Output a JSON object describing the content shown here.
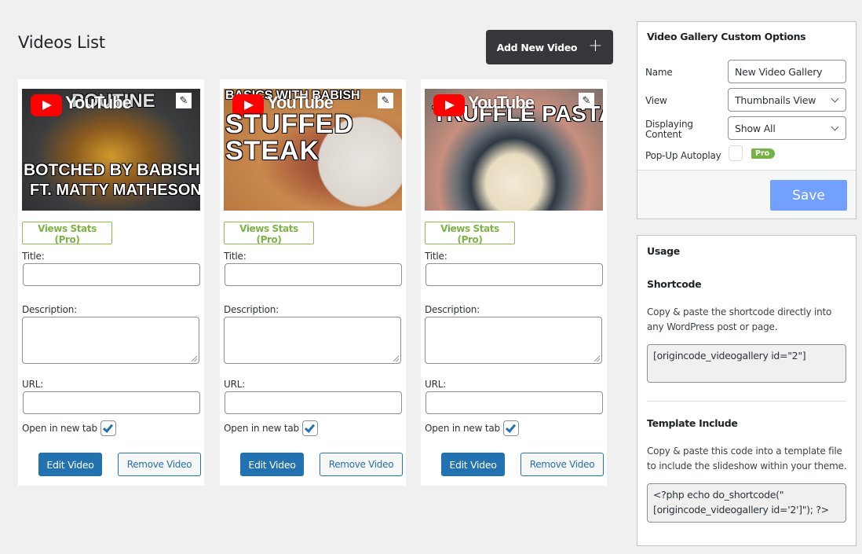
{
  "page": {
    "title": "Videos List",
    "add_button_label": "Add New Video",
    "add_button_icon": "plus-icon"
  },
  "videos": [
    {
      "thumbnail": {
        "brand_text": "YouTube",
        "overlay_top": "POUTINE",
        "headline_lines": [
          "BOTCHED BY BABISH",
          "FT. MATTY MATHESON"
        ]
      },
      "views_stats_label": "Views Stats (Pro)",
      "title_label": "Title:",
      "title_value": "",
      "description_label": "Description:",
      "description_value": "",
      "url_label": "URL:",
      "url_value": "",
      "open_new_tab_label": "Open in new tab",
      "open_new_tab_checked": true,
      "edit_label": "Edit Video",
      "remove_label": "Remove Video"
    },
    {
      "thumbnail": {
        "brand_text": "YouTube",
        "overlay_top": "BASICS WITH BABISH",
        "headline_lines": [
          "STUFFED",
          "STEAK"
        ]
      },
      "views_stats_label": "Views Stats (Pro)",
      "title_label": "Title:",
      "title_value": "",
      "description_label": "Description:",
      "description_value": "",
      "url_label": "URL:",
      "url_value": "",
      "open_new_tab_label": "Open in new tab",
      "open_new_tab_checked": true,
      "edit_label": "Edit Video",
      "remove_label": "Remove Video"
    },
    {
      "thumbnail": {
        "brand_text": "YouTube",
        "overlay_top": "TRUFFLE PASTA",
        "headline_lines": []
      },
      "views_stats_label": "Views Stats (Pro)",
      "title_label": "Title:",
      "title_value": "",
      "description_label": "Description:",
      "description_value": "",
      "url_label": "URL:",
      "url_value": "",
      "open_new_tab_label": "Open in new tab",
      "open_new_tab_checked": true,
      "edit_label": "Edit Video",
      "remove_label": "Remove Video"
    }
  ],
  "options_panel": {
    "title": "Video Gallery Custom Options",
    "name_label": "Name",
    "name_value": "New Video Gallery",
    "view_label": "View",
    "view_value": "Thumbnails View",
    "content_label_line1": "Displaying",
    "content_label_line2": "Content",
    "content_value": "Show All",
    "autoplay_label": "Pop-Up Autoplay",
    "autoplay_checked": false,
    "pro_badge": "Pro",
    "save_label": "Save"
  },
  "usage_panel": {
    "title": "Usage",
    "shortcode_heading": "Shortcode",
    "shortcode_description": "Copy & paste the shortcode directly into any WordPress post or page.",
    "shortcode_value": "[origincode_videogallery id=\"2\"]",
    "template_heading": "Template Include",
    "template_description": "Copy & paste this code into a template file to include the slideshow within your theme.",
    "template_code": "<?php echo do_shortcode(\"[origincode_videogallery id='2']\"); ?>"
  },
  "colors": {
    "background": "#f0f0f1",
    "primary_blue": "#2271b1",
    "dark_button": "#36373b",
    "pro_green": "#7cb342",
    "save_button": "#72a0ff",
    "youtube_red": "#ff0000"
  }
}
